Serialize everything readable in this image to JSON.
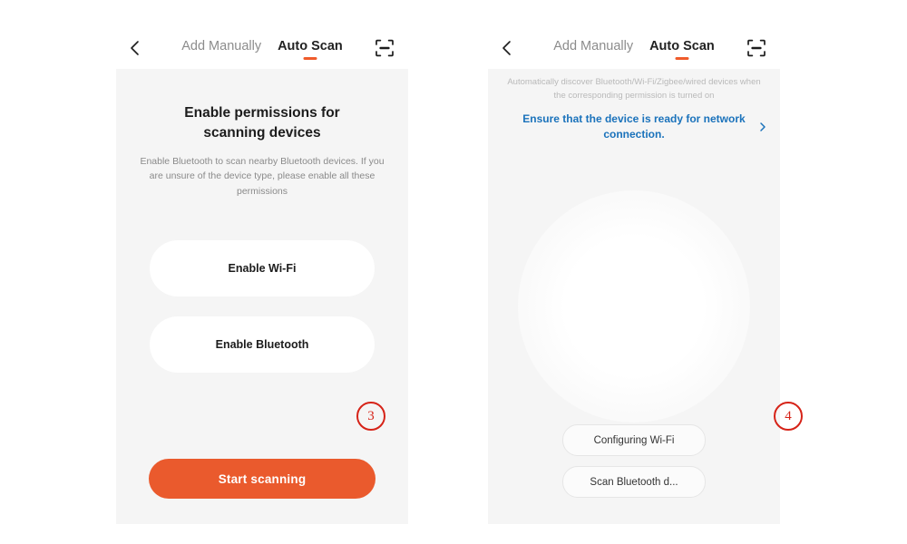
{
  "app": {
    "accent_orange": "#ea5a2d",
    "link_blue": "#1a72bb",
    "badge_red": "#d62318",
    "panel_bg": "#f5f5f5"
  },
  "left_phone": {
    "header": {
      "back_icon": "chevron-left-icon",
      "scan_icon": "scan-frame-icon",
      "tabs": [
        {
          "label": "Add Manually",
          "active": false
        },
        {
          "label": "Auto Scan",
          "active": true
        }
      ]
    },
    "title": "Enable permissions for scanning devices",
    "description": "Enable Bluetooth to scan nearby Bluetooth devices. If you are unsure of the device type, please enable all these permissions",
    "buttons": [
      {
        "label": "Enable Wi-Fi"
      },
      {
        "label": "Enable Bluetooth"
      }
    ],
    "cta": {
      "label": "Start scanning"
    },
    "badge": "3"
  },
  "right_phone": {
    "header": {
      "back_icon": "chevron-left-icon",
      "scan_icon": "scan-frame-icon",
      "tabs": [
        {
          "label": "Add Manually",
          "active": false
        },
        {
          "label": "Auto Scan",
          "active": true
        }
      ]
    },
    "description": "Automatically discover Bluetooth/Wi-Fi/Zigbee/wired devices when the corresponding permission is turned on",
    "ready_link": "Ensure that the device is ready for network connection.",
    "ready_link_chevron": "chevron-right-icon",
    "buttons": [
      {
        "label": "Configuring Wi-Fi"
      },
      {
        "label": "Scan Bluetooth d..."
      }
    ],
    "badge": "4"
  }
}
